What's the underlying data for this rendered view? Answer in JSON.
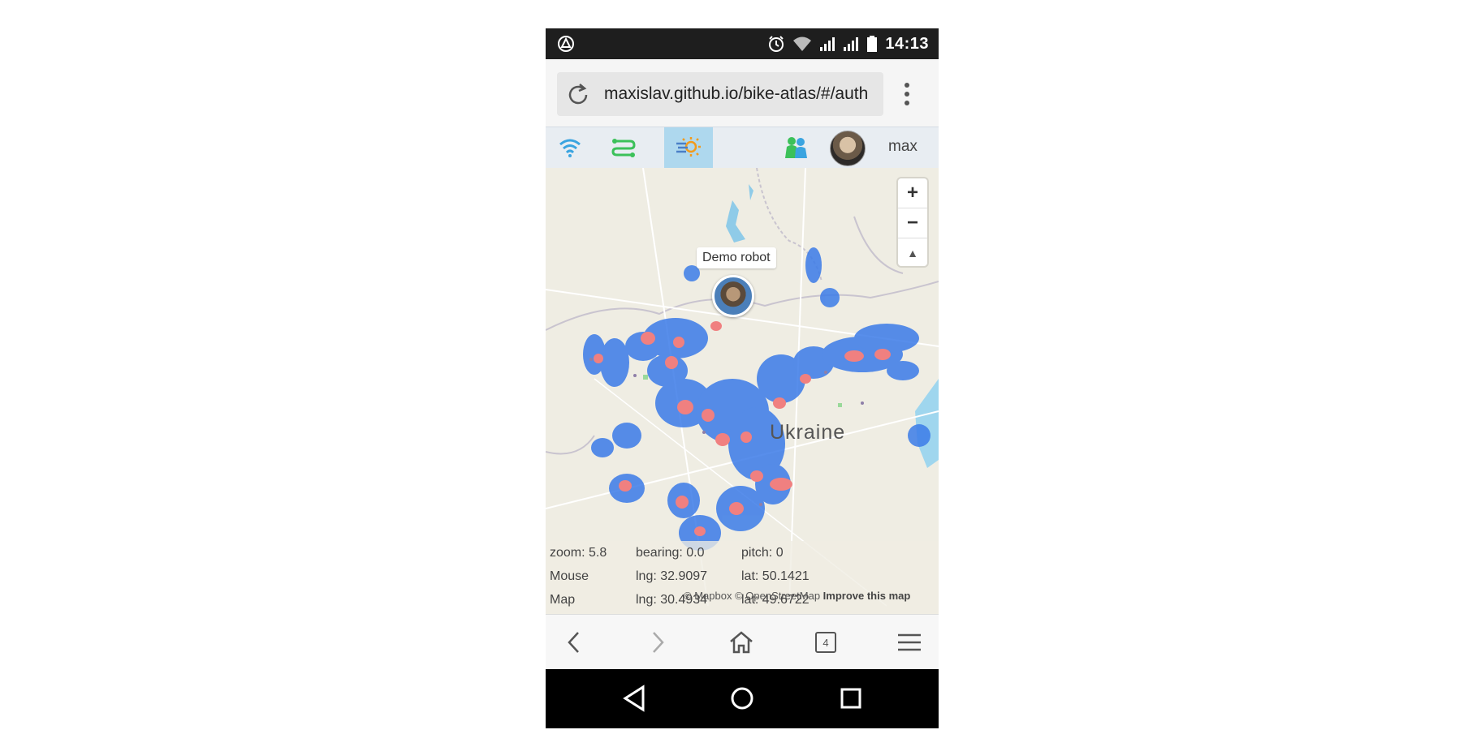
{
  "status_bar": {
    "time": "14:13",
    "icons": [
      "app-notification-icon",
      "alarm-icon",
      "wifi-icon",
      "signal-icon",
      "signal-icon",
      "battery-icon"
    ]
  },
  "browser": {
    "url": "maxislav.github.io/bike-atlas/#/auth",
    "icons": [
      "reload-icon",
      "overflow-menu-icon"
    ]
  },
  "app_toolbar": {
    "buttons": [
      "wifi-icon",
      "route-icon",
      "weather-icon",
      "friends-icon"
    ],
    "username": "max"
  },
  "map": {
    "zoom_in": "+",
    "zoom_out": "−",
    "compass": "▲",
    "robot_label": "Demo robot",
    "country_label": "Ukraine",
    "info": {
      "zoom_label": "zoom: 5.8",
      "bearing_label": "bearing: 0.0",
      "pitch_label": "pitch: 0",
      "mouse_label": "Mouse",
      "mouse_lng": "lng: 32.9097",
      "mouse_lat": "lat: 50.1421",
      "map_label": "Map",
      "map_lng": "lng: 30.4934",
      "map_lat": "lat: 49.6722"
    },
    "attribution": {
      "mapbox": "© Mapbox",
      "osm": "© OpenStreetMap",
      "improve": "Improve this map"
    }
  },
  "bottom_nav": {
    "tab_count": "4",
    "icons": [
      "back-icon",
      "forward-icon",
      "home-icon",
      "tabs-icon",
      "menu-icon"
    ]
  },
  "colors": {
    "heat_low": "#3b7be8",
    "heat_high": "#f08080",
    "active_tab": "#aed8ee",
    "map_land": "#efede3"
  }
}
